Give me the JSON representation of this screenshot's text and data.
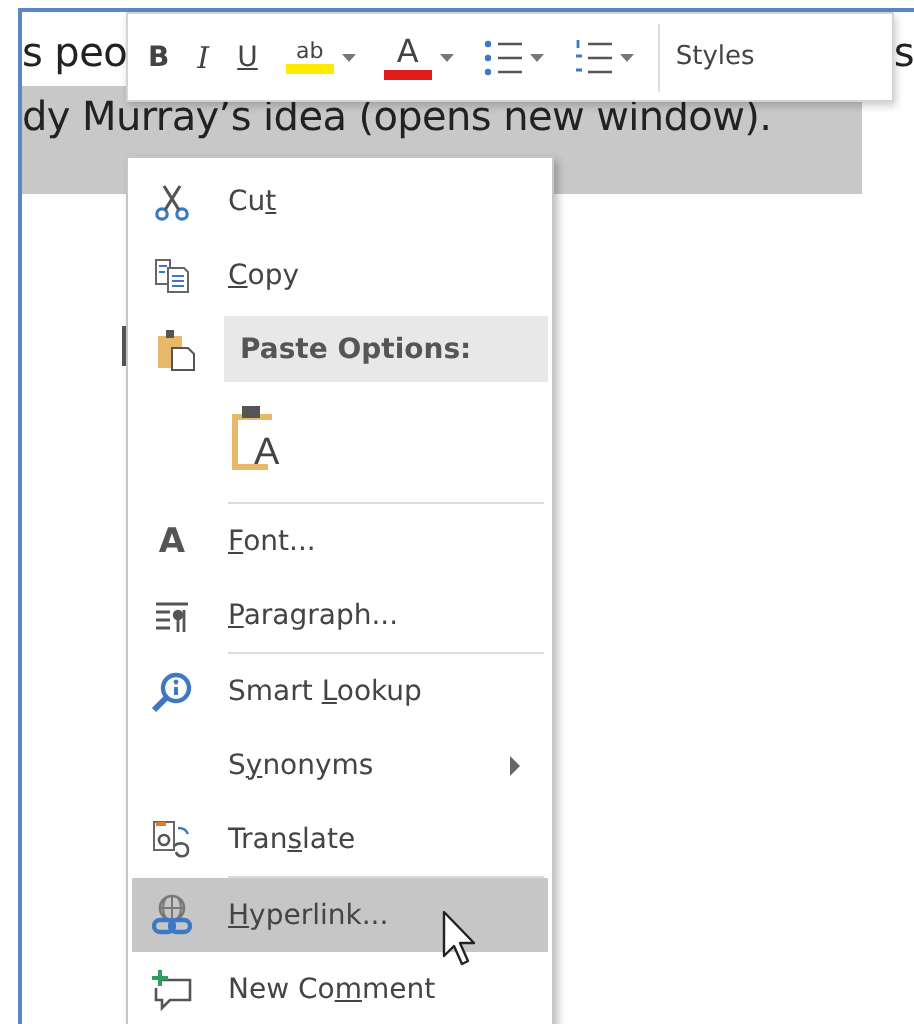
{
  "document": {
    "lines": [
      {
        "texts": [
          "s peo",
          "s"
        ],
        "selected": false
      },
      {
        "texts": [
          "dy Murray’s idea (opens new window)."
        ],
        "selected": true
      }
    ]
  },
  "mini_toolbar": {
    "items": [
      {
        "kind": "bold",
        "glyph": "B",
        "dropdown": false
      },
      {
        "kind": "italic",
        "glyph": "I",
        "dropdown": false
      },
      {
        "kind": "underline",
        "glyph": "U",
        "dropdown": false
      },
      {
        "kind": "highlight",
        "glyph": "ab",
        "dropdown": true
      },
      {
        "kind": "font_color",
        "glyph": "A",
        "dropdown": true
      },
      {
        "kind": "bullets",
        "dropdown": true
      },
      {
        "kind": "numbering",
        "dropdown": true
      },
      {
        "kind": "styles",
        "label": "Styles",
        "dropdown": false
      }
    ]
  },
  "context_menu": {
    "items": [
      {
        "kind": "command",
        "label": {
          "before": "Cu",
          "key": "t"
        },
        "selected": false
      },
      {
        "kind": "command",
        "label": {
          "key": "C",
          "after": "opy"
        },
        "selected": false
      },
      {
        "kind": "header",
        "label": "Paste Options:"
      },
      {
        "kind": "paste_option",
        "icon_text": "A"
      },
      {
        "kind": "separator"
      },
      {
        "kind": "command",
        "label": {
          "key": "F",
          "after": "ont..."
        },
        "icon_text": "A",
        "selected": false
      },
      {
        "kind": "command",
        "label": {
          "key": "P",
          "after": "aragraph..."
        },
        "selected": false
      },
      {
        "kind": "separator"
      },
      {
        "kind": "command",
        "label": {
          "before": "Smart ",
          "key": "L",
          "after": "ookup"
        },
        "selected": false
      },
      {
        "kind": "submenu",
        "label": {
          "before": "S",
          "key": "y",
          "after": "nonyms"
        },
        "selected": false
      },
      {
        "kind": "command",
        "label": {
          "before": "Tran",
          "key": "s",
          "after": "late"
        },
        "selected": false
      },
      {
        "kind": "separator"
      },
      {
        "kind": "command",
        "label": {
          "key": "H",
          "after": "yperlink..."
        },
        "selected": true
      },
      {
        "kind": "command",
        "label": {
          "before": "New Co",
          "key": "m",
          "after": "ment"
        },
        "selected": false
      }
    ]
  }
}
